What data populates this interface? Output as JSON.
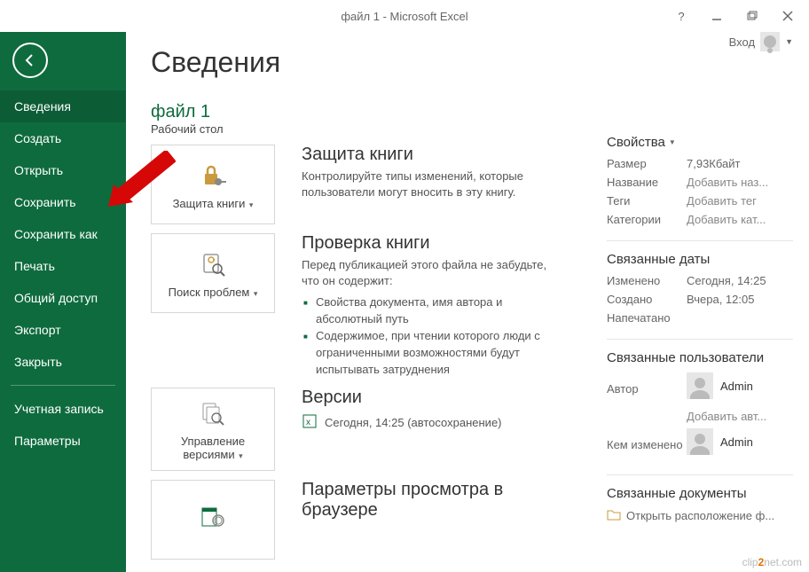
{
  "window": {
    "title": "файл 1 - Microsoft Excel",
    "account_label": "Вход"
  },
  "sidebar": {
    "items": [
      {
        "label": "Сведения",
        "active": true
      },
      {
        "label": "Создать"
      },
      {
        "label": "Открыть"
      },
      {
        "label": "Сохранить"
      },
      {
        "label": "Сохранить как"
      },
      {
        "label": "Печать"
      },
      {
        "label": "Общий доступ"
      },
      {
        "label": "Экспорт"
      },
      {
        "label": "Закрыть"
      }
    ],
    "lower": [
      {
        "label": "Учетная запись"
      },
      {
        "label": "Параметры"
      }
    ]
  },
  "page": {
    "title": "Сведения",
    "file_name": "файл 1",
    "file_path": "Рабочий стол"
  },
  "sections": {
    "protect": {
      "tile_label": "Защита книги",
      "title": "Защита книги",
      "desc": "Контролируйте типы изменений, которые пользователи могут вносить в эту книгу."
    },
    "inspect": {
      "tile_label": "Поиск проблем",
      "title": "Проверка книги",
      "desc": "Перед публикацией этого файла не забудьте, что он содержит:",
      "bullet1": "Свойства документа, имя автора и абсолютный путь",
      "bullet2": "Содержимое, при чтении которого люди с ограниченными возможностями будут испытывать затруднения"
    },
    "versions": {
      "tile_label": "Управление версиями",
      "title": "Версии",
      "line": "Сегодня, 14:25 (автосохранение)"
    },
    "browser_view": {
      "title": "Параметры просмотра в браузере"
    }
  },
  "props": {
    "header": "Свойства",
    "size_label": "Размер",
    "size_value": "7,93Кбайт",
    "title_label": "Название",
    "title_value": "Добавить наз...",
    "tags_label": "Теги",
    "tags_value": "Добавить тег",
    "categories_label": "Категории",
    "categories_value": "Добавить кат..."
  },
  "dates": {
    "header": "Связанные даты",
    "modified_label": "Изменено",
    "modified_value": "Сегодня, 14:25",
    "created_label": "Создано",
    "created_value": "Вчера, 12:05",
    "printed_label": "Напечатано"
  },
  "users": {
    "header": "Связанные пользователи",
    "author_label": "Автор",
    "author_name": "Admin",
    "add_author": "Добавить авт...",
    "modified_by_label": "Кем изменено",
    "modified_by_name": "Admin"
  },
  "docs": {
    "header": "Связанные документы",
    "open_location": "Открыть расположение ф..."
  },
  "watermark": {
    "pre": "clip",
    "mid": "2",
    "post": "net",
    "suf": ".com"
  }
}
